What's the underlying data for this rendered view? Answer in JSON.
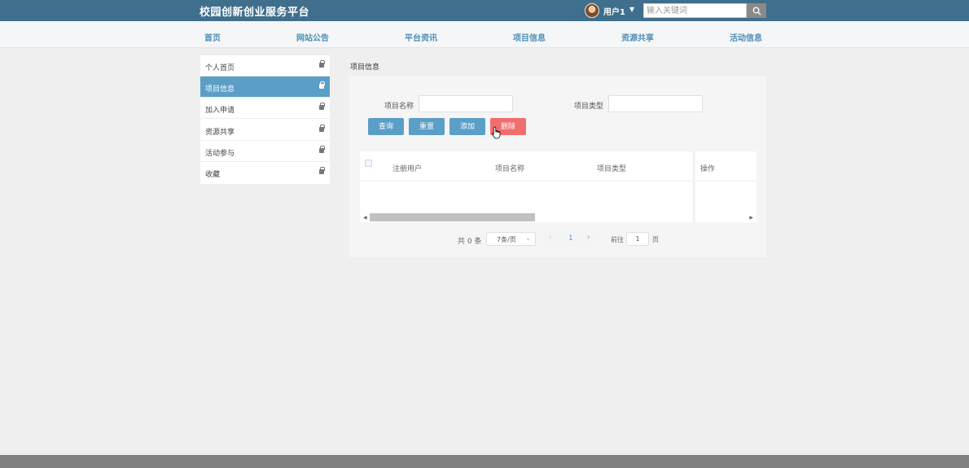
{
  "header": {
    "brand": "校园创新创业服务平台",
    "username": "用户1",
    "caret": "▼",
    "search_placeholder": "输入关键词",
    "colors": {
      "bar": "#3f6f8c",
      "accent": "#5b9ec6",
      "danger": "#f06e6e"
    }
  },
  "nav": [
    "首页",
    "网站公告",
    "平台资讯",
    "项目信息",
    "资源共享",
    "活动信息"
  ],
  "sidebar": {
    "items": [
      {
        "label": "个人首页",
        "icon": "lock-icon",
        "active": false
      },
      {
        "label": "项目信息",
        "icon": "lock-icon",
        "active": true
      },
      {
        "label": "加入申请",
        "icon": "lock-icon",
        "active": false
      },
      {
        "label": "资源共享",
        "icon": "lock-icon",
        "active": false
      },
      {
        "label": "活动参与",
        "icon": "lock-icon",
        "active": false
      },
      {
        "label": "收藏",
        "icon": "lock-icon",
        "active": false
      }
    ]
  },
  "main": {
    "breadcrumb": "项目信息",
    "form": {
      "name_label": "项目名称",
      "type_label": "项目类型",
      "name_value": "",
      "type_value": ""
    },
    "buttons": {
      "query": "查询",
      "reset": "重置",
      "add": "添加",
      "delete": "删除"
    },
    "table": {
      "columns": [
        "注册用户",
        "项目名称",
        "项目类型",
        "操作"
      ],
      "rows": []
    },
    "pagination": {
      "total": "共 0 条",
      "page_size": "7条/页",
      "current_page": "1",
      "goto_label": "前往",
      "goto_value": "1",
      "page_unit": "页"
    }
  }
}
